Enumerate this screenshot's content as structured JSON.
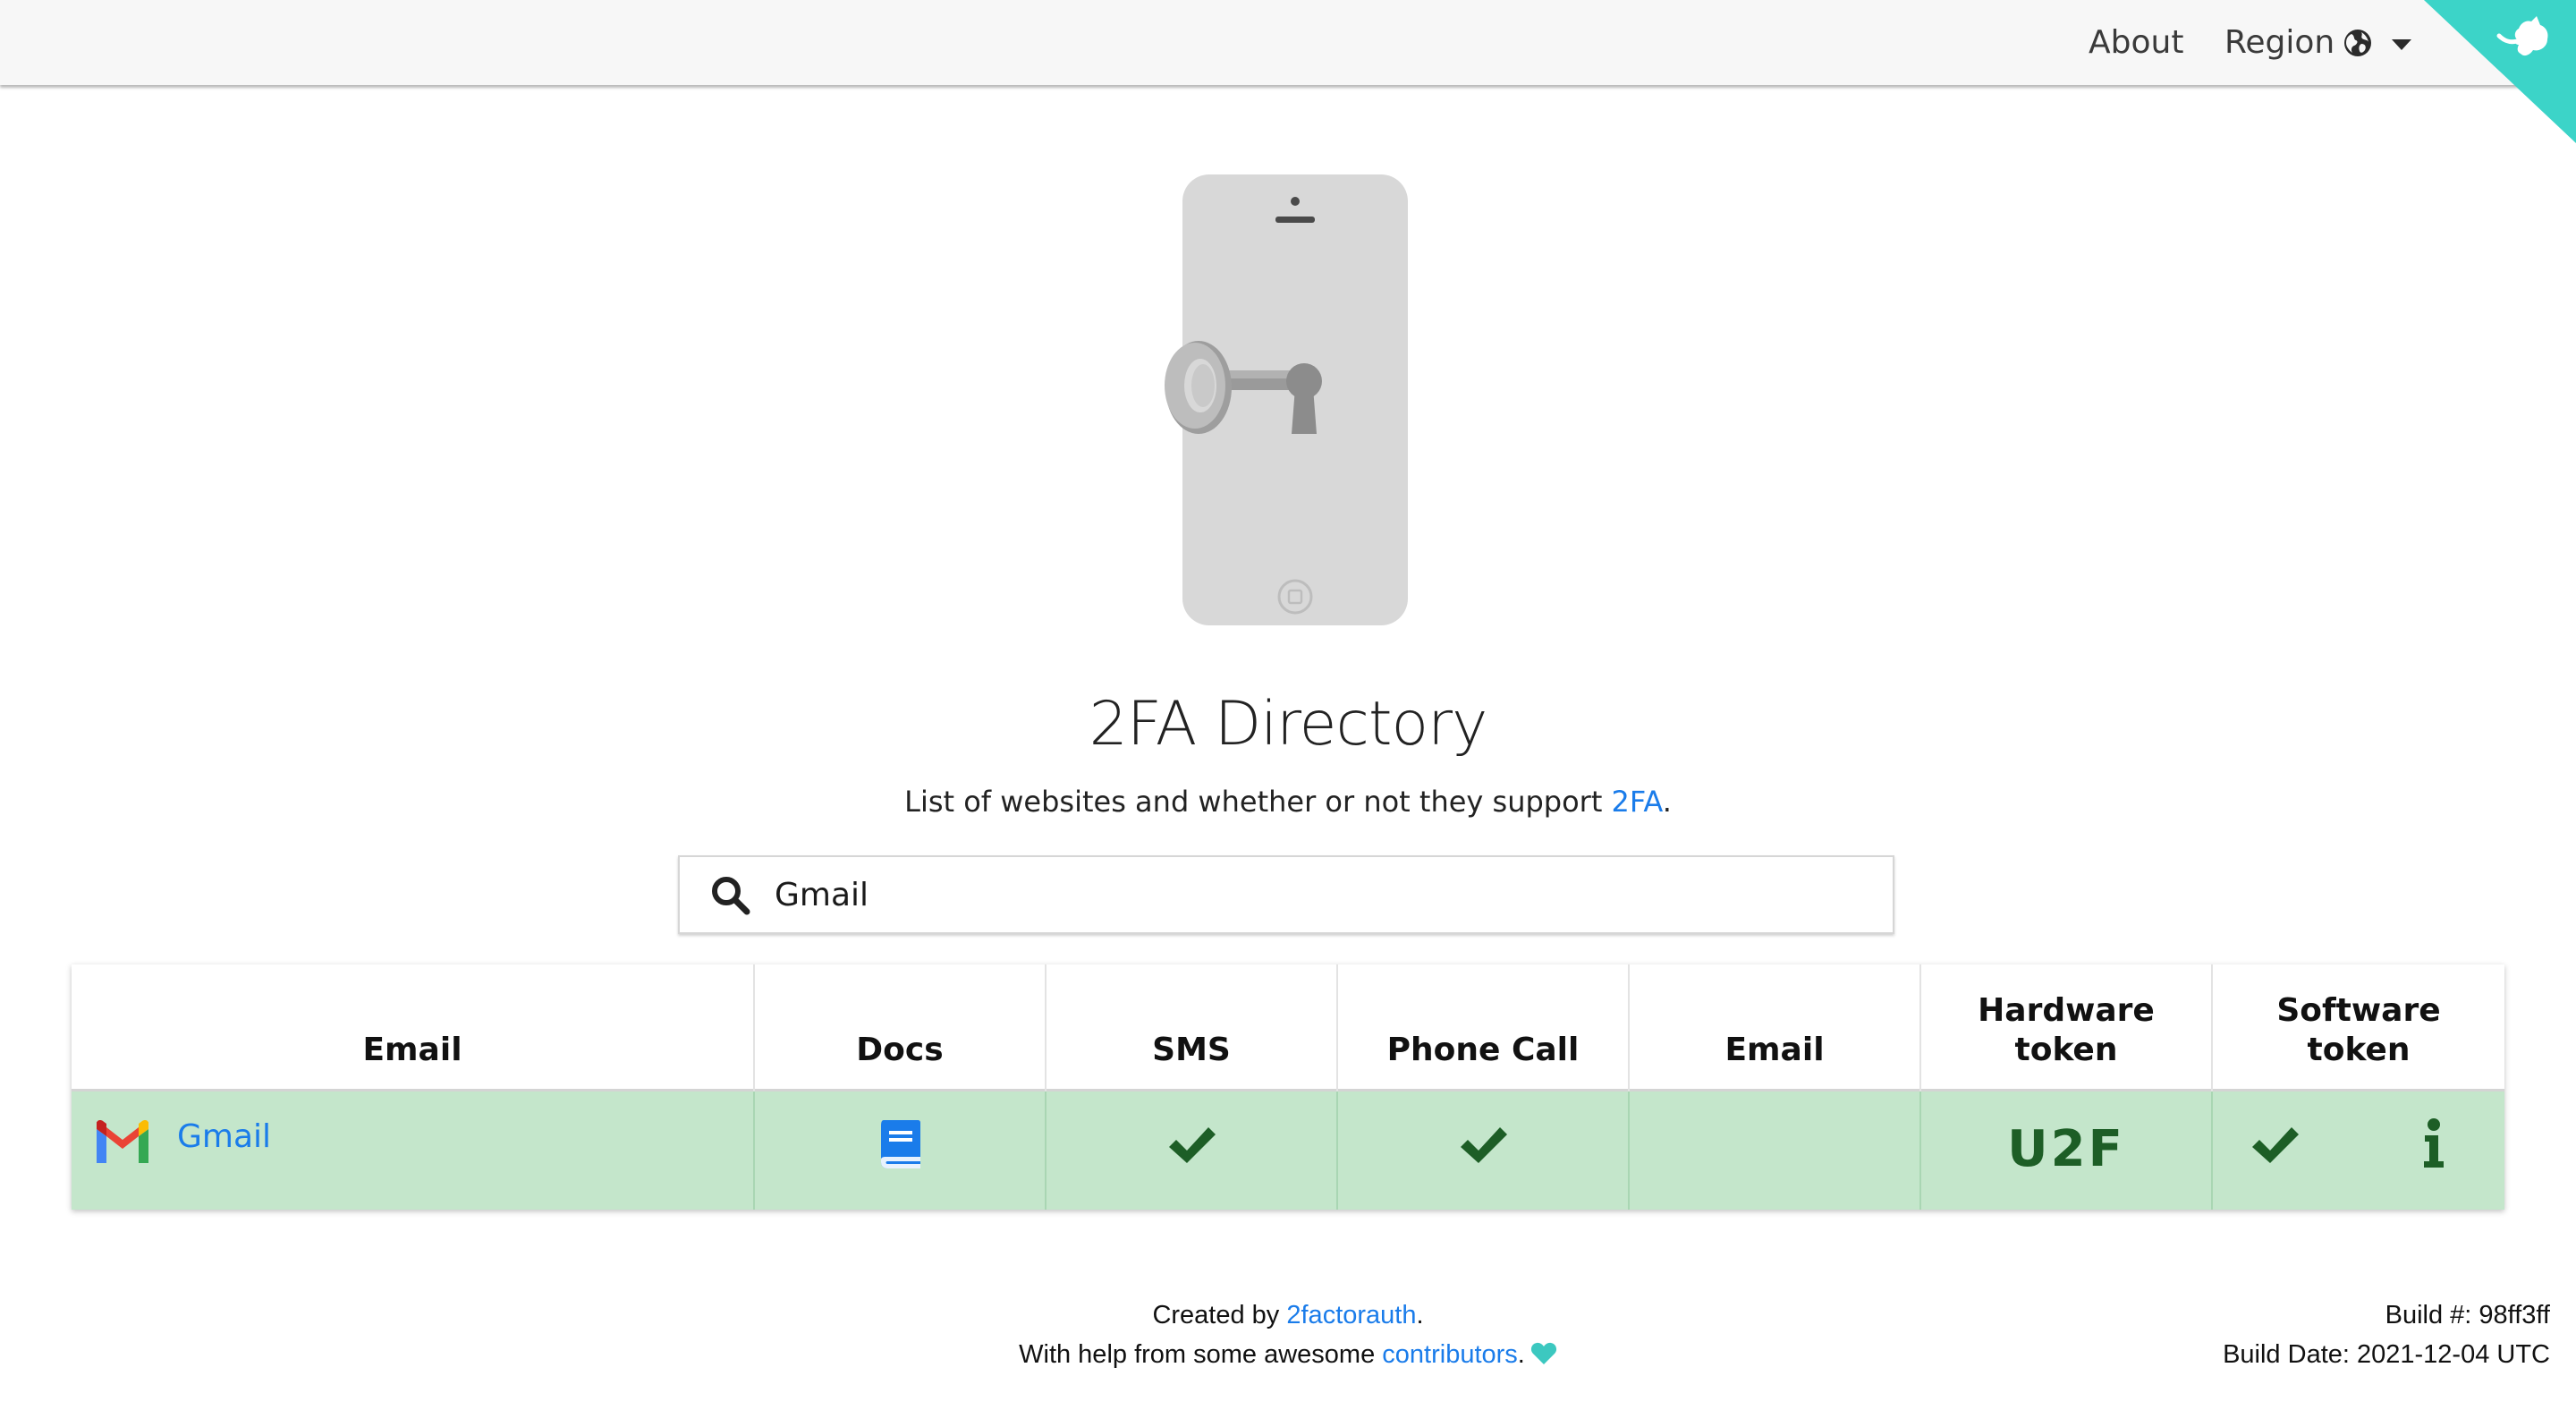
{
  "nav": {
    "about_label": "About",
    "region_label": "Region",
    "region_icon": "globe-icon",
    "corner_icon": "github-corner-icon"
  },
  "header": {
    "hero_image": "phone-with-key-illustration",
    "title": "2FA Directory",
    "subtitle_prefix": "List of websites and whether or not they support ",
    "subtitle_link": "2FA",
    "subtitle_suffix": "."
  },
  "search": {
    "icon": "search-icon",
    "value": "Gmail",
    "placeholder": ""
  },
  "table": {
    "columns": [
      "Email",
      "Docs",
      "SMS",
      "Phone Call",
      "Email",
      "Hardware token",
      "Software token"
    ],
    "columns_display": {
      "hardware_line1": "Hardware",
      "hardware_line2": "token",
      "software_line1": "Software",
      "software_line2": "token"
    },
    "rows": [
      {
        "logo": "gmail-logo",
        "name": "Gmail",
        "docs": "book-icon",
        "sms": true,
        "phone_call": true,
        "email": false,
        "hardware_token": "U2F",
        "software_token": true,
        "software_info": "info-icon"
      }
    ]
  },
  "footer": {
    "created_by_prefix": "Created by ",
    "created_by_link": "2factorauth",
    "created_by_suffix": ".",
    "help_prefix": "With help from some awesome ",
    "help_link": "contributors",
    "help_suffix": ".",
    "heart_icon": "heart-icon",
    "build_number": "Build #: 98ff3ff",
    "build_date": "Build Date: 2021-12-04 UTC"
  },
  "colors": {
    "accent_link": "#1a7cea",
    "row_supported_bg": "#c4e6cb",
    "check_green": "#1d5e26",
    "corner_teal": "#3cd4c8",
    "heart_teal": "#3cc8c0",
    "docs_blue": "#1a7cea"
  }
}
